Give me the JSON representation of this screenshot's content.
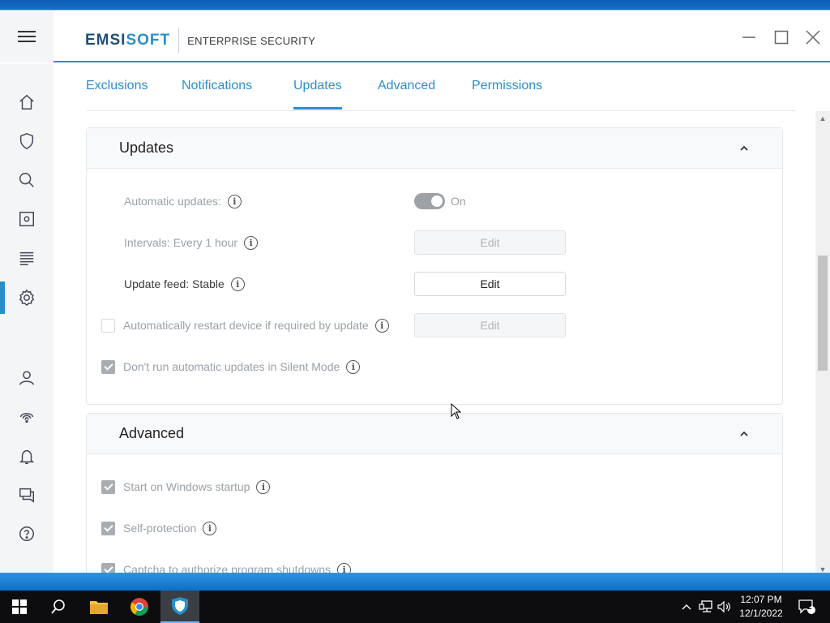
{
  "app": {
    "brand_prefix": "EMSI",
    "brand_suffix": "SOFT",
    "product": "ENTERPRISE SECURITY"
  },
  "tabs": [
    {
      "label": "Exclusions"
    },
    {
      "label": "Notifications"
    },
    {
      "label": "Updates",
      "active": true
    },
    {
      "label": "Advanced"
    },
    {
      "label": "Permissions"
    }
  ],
  "updates_section": {
    "title": "Updates",
    "automatic_updates": {
      "label": "Automatic updates:",
      "state": "On"
    },
    "intervals": {
      "label": "Intervals: Every 1 hour",
      "button": "Edit"
    },
    "update_feed": {
      "label": "Update feed: Stable",
      "button": "Edit"
    },
    "auto_restart": {
      "label": "Automatically restart device if required by update",
      "checked": false,
      "button": "Edit"
    },
    "silent_mode": {
      "label": "Don't run automatic updates in Silent Mode",
      "checked": true
    }
  },
  "advanced_section": {
    "title": "Advanced",
    "items": [
      {
        "label": "Start on Windows startup",
        "checked": true
      },
      {
        "label": "Self-protection",
        "checked": true
      },
      {
        "label": "Captcha to authorize program shutdowns",
        "checked": true
      }
    ]
  },
  "info_glyph": "i",
  "sidebar_icons": [
    "home-icon",
    "shield-icon",
    "search-icon",
    "scan-icon",
    "logs-icon",
    "settings-icon",
    "user-icon",
    "fingerprint-icon",
    "bell-icon",
    "chat-icon",
    "help-icon"
  ],
  "taskbar": {
    "time": "12:07 PM",
    "date": "12/1/2022",
    "notification_count": "2"
  },
  "colors": {
    "accent": "#2a8fc9",
    "brand_dark": "#1b4f7a",
    "disabled_text": "#9aa0a6"
  }
}
